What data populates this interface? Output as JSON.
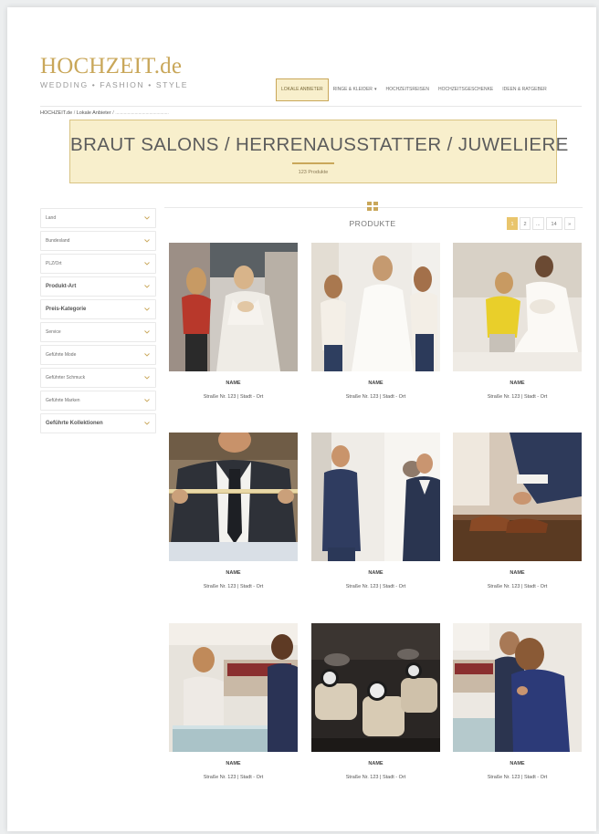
{
  "header": {
    "logo_main": "HOCHZEIT.de",
    "logo_sub": "WEDDING  •  FASHION  •  STYLE",
    "nav": [
      {
        "label": "LOKALE ANBIETER",
        "active": true,
        "dropdown": false
      },
      {
        "label": "RINGE & KLEIDER",
        "active": false,
        "dropdown": true
      },
      {
        "label": "HOCHZEITSREISEN",
        "active": false,
        "dropdown": false
      },
      {
        "label": "HOCHZEITSGESCHENKE",
        "active": false,
        "dropdown": false
      },
      {
        "label": "IDEEN & RATGEBER",
        "active": false,
        "dropdown": false
      }
    ]
  },
  "breadcrumb": {
    "root": "HOCHZEIT.de",
    "current": "Lokale Anbieter",
    "separator": "/",
    "trail": "............................................"
  },
  "banner": {
    "title": "BRAUT SALONS / HERRENAUSSTATTER / JUWELIERE",
    "count": "123 Produkte"
  },
  "filters": [
    {
      "label": "Land",
      "bold": false
    },
    {
      "label": "Bundesland",
      "bold": false
    },
    {
      "label": "PLZ/Ort",
      "bold": false
    },
    {
      "label": "Produkt-Art",
      "bold": true
    },
    {
      "label": "Preis-Kategorie",
      "bold": true
    },
    {
      "label": "Service",
      "bold": false
    },
    {
      "label": "Geführte Mode",
      "bold": false
    },
    {
      "label": "Geführter Schmuck",
      "bold": false
    },
    {
      "label": "Geführte Marken",
      "bold": false
    },
    {
      "label": "Geführte Kollektionen",
      "bold": true
    }
  ],
  "products_title": "PRODUKTE",
  "pagination": {
    "pages": [
      "1",
      "2",
      "...",
      "14",
      "»"
    ],
    "current": "1"
  },
  "products": [
    {
      "name": "NAME",
      "address": "Straße Nr. 123  |  Stadt - Ort",
      "image": "bridal-salon-consultation"
    },
    {
      "name": "NAME",
      "address": "Straße Nr. 123  |  Stadt - Ort",
      "image": "bride-fitting-dress"
    },
    {
      "name": "NAME",
      "address": "Straße Nr. 123  |  Stadt - Ort",
      "image": "bride-seated-in-gown"
    },
    {
      "name": "NAME",
      "address": "Straße Nr. 123  |  Stadt - Ort",
      "image": "suit-measuring-tape"
    },
    {
      "name": "NAME",
      "address": "Straße Nr. 123  |  Stadt - Ort",
      "image": "groom-suit-fitting"
    },
    {
      "name": "NAME",
      "address": "Straße Nr. 123  |  Stadt - Ort",
      "image": "groom-shoes"
    },
    {
      "name": "NAME",
      "address": "Straße Nr. 123  |  Stadt - Ort",
      "image": "jeweler-counter"
    },
    {
      "name": "NAME",
      "address": "Straße Nr. 123  |  Stadt - Ort",
      "image": "watches-display"
    },
    {
      "name": "NAME",
      "address": "Straße Nr. 123  |  Stadt - Ort",
      "image": "couple-jewelry-shop"
    }
  ],
  "colors": {
    "gold": "#c9a75a",
    "banner_bg": "#f8efcc",
    "page_active": "#e9c56c"
  }
}
